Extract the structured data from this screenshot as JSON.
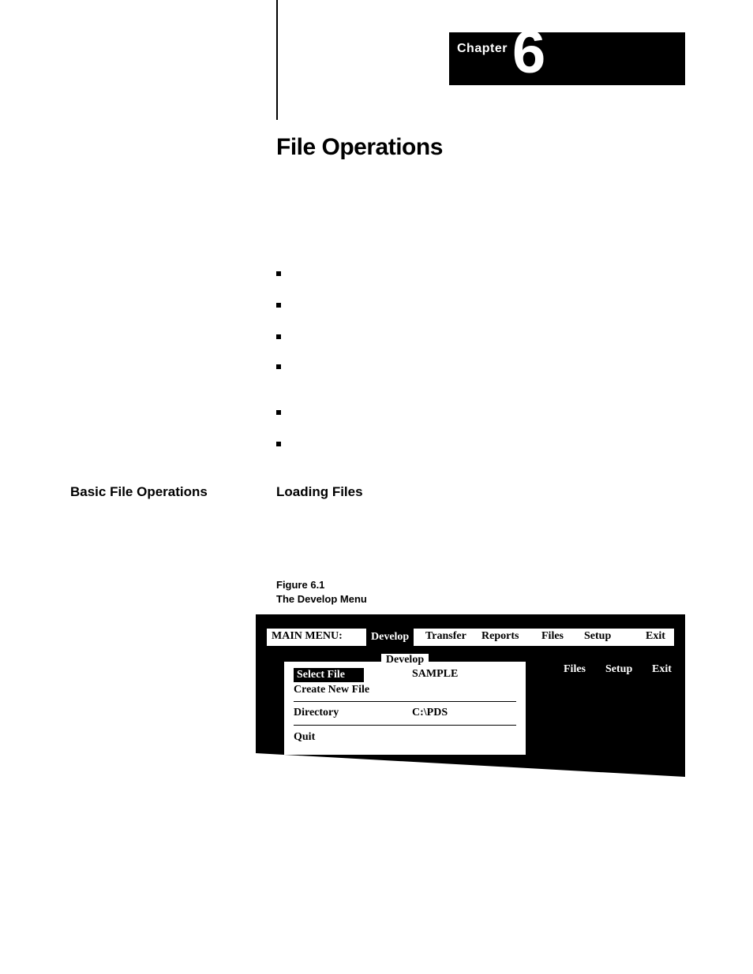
{
  "chapter": {
    "label": "Chapter",
    "number": "6"
  },
  "title": "File Operations",
  "left_heading": "Basic File Operations",
  "right_heading": "Loading Files",
  "figure": {
    "number": "Figure 6.1",
    "caption": "The Develop Menu"
  },
  "tui": {
    "menubar": {
      "title": "MAIN MENU:",
      "items": [
        "Develop",
        "Transfer",
        "Reports",
        "Files",
        "Setup",
        "Exit"
      ],
      "active": "Develop"
    },
    "menubar2": {
      "items": [
        "Files",
        "Setup",
        "Exit"
      ]
    },
    "dropdown": {
      "legend": "Develop",
      "select_file": {
        "label": "Select File",
        "value": "SAMPLE"
      },
      "create_new": {
        "label": "Create New File"
      },
      "directory": {
        "label": "Directory",
        "value": "C:\\PDS"
      },
      "quit": {
        "label": "Quit"
      }
    }
  }
}
